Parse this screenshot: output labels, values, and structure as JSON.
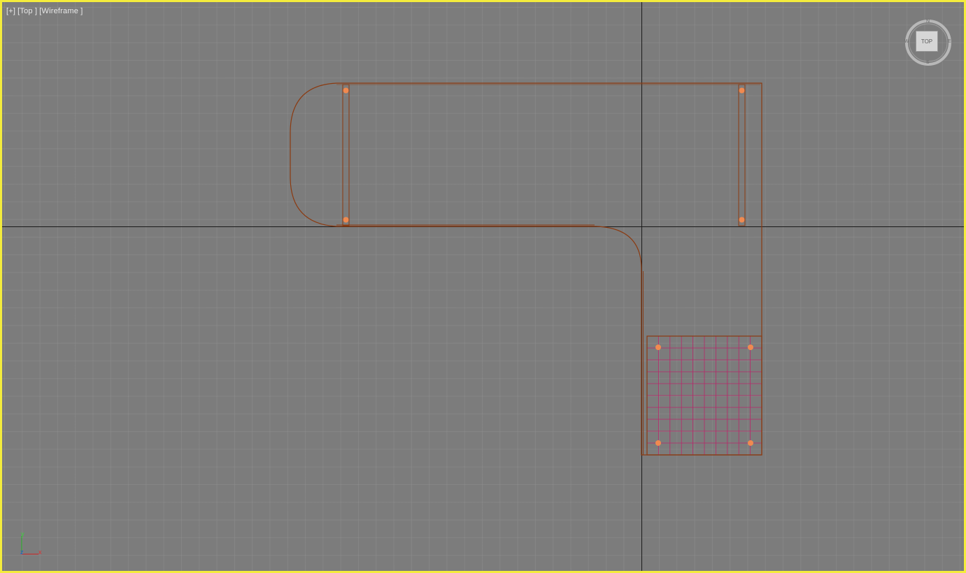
{
  "viewport": {
    "label_parts": [
      "[+]",
      "[Top ]",
      "[Wireframe ]"
    ],
    "active_border_color": "#f4ec3c",
    "background_color": "#7c7c7c"
  },
  "viewcube": {
    "face_label": "TOP",
    "compass": {
      "north": "N",
      "south": "S",
      "east": "E",
      "west": "W"
    }
  },
  "axis_tripod": {
    "y_label": "y",
    "z_label": "z",
    "x_label": "x",
    "colors": {
      "x": "#d02020",
      "y": "#20b020",
      "z": "#2040d0"
    }
  },
  "scene": {
    "wire_color": "#8b3a10",
    "vertex_color": "#f08a50",
    "grid_object_color": "#b8286a",
    "world_axis_color": "#1a1a1a"
  }
}
